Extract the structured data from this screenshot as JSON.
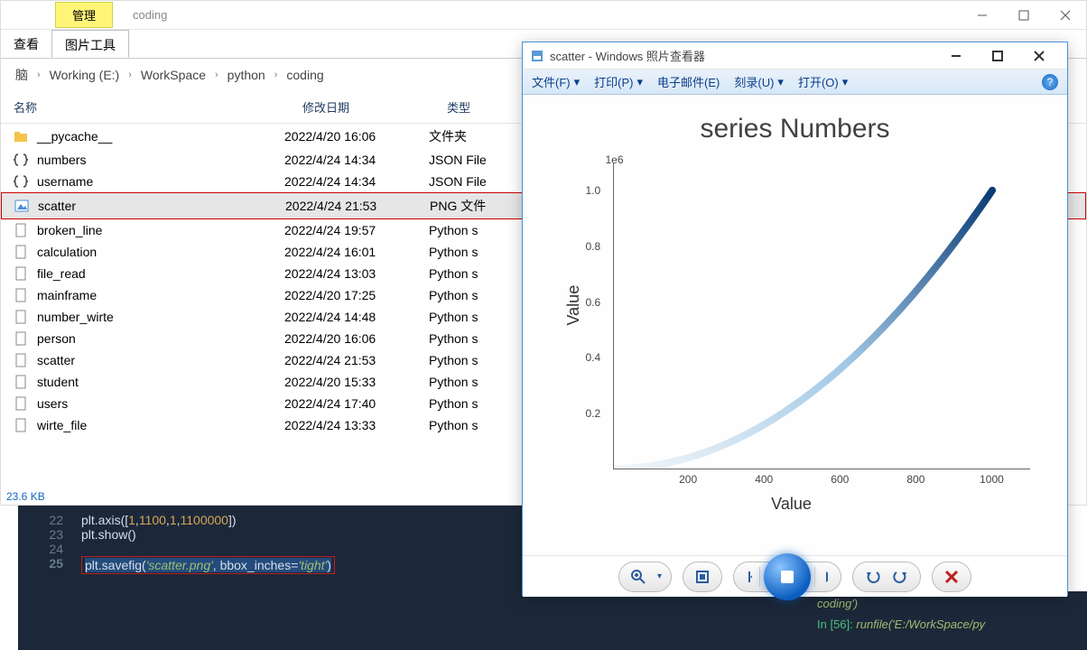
{
  "explorer": {
    "tabs": {
      "highlighted": "管理",
      "secondary": "coding"
    },
    "menubar": {
      "view": "查看",
      "imageTools": "图片工具"
    },
    "breadcrumb": [
      "脑",
      "Working (E:)",
      "WorkSpace",
      "python",
      "coding"
    ],
    "columns": {
      "name": "名称",
      "date": "修改日期",
      "type": "类型"
    },
    "files": [
      {
        "icon": "folder",
        "name": "__pycache__",
        "date": "2022/4/20 16:06",
        "type": "文件夹"
      },
      {
        "icon": "json",
        "name": "numbers",
        "date": "2022/4/24 14:34",
        "type": "JSON File"
      },
      {
        "icon": "json",
        "name": "username",
        "date": "2022/4/24 14:34",
        "type": "JSON File"
      },
      {
        "icon": "image",
        "name": "scatter",
        "date": "2022/4/24 21:53",
        "type": "PNG 文件",
        "selected": true
      },
      {
        "icon": "generic",
        "name": "broken_line",
        "date": "2022/4/24 19:57",
        "type": "Python s"
      },
      {
        "icon": "generic",
        "name": "calculation",
        "date": "2022/4/24 16:01",
        "type": "Python s"
      },
      {
        "icon": "generic",
        "name": "file_read",
        "date": "2022/4/24 13:03",
        "type": "Python s"
      },
      {
        "icon": "generic",
        "name": "mainframe",
        "date": "2022/4/20 17:25",
        "type": "Python s"
      },
      {
        "icon": "generic",
        "name": "number_wirte",
        "date": "2022/4/24 14:48",
        "type": "Python s"
      },
      {
        "icon": "generic",
        "name": "person",
        "date": "2022/4/20 16:06",
        "type": "Python s"
      },
      {
        "icon": "generic",
        "name": "scatter",
        "date": "2022/4/24 21:53",
        "type": "Python s"
      },
      {
        "icon": "generic",
        "name": "student",
        "date": "2022/4/20 15:33",
        "type": "Python s"
      },
      {
        "icon": "generic",
        "name": "users",
        "date": "2022/4/24 17:40",
        "type": "Python s"
      },
      {
        "icon": "generic",
        "name": "wirte_file",
        "date": "2022/4/24 13:33",
        "type": "Python s"
      }
    ],
    "status": "23.6 KB"
  },
  "photoviewer": {
    "title": "scatter - Windows 照片查看器",
    "menu": {
      "file": "文件(F)",
      "print": "打印(P)",
      "email": "电子邮件(E)",
      "burn": "刻录(U)",
      "open": "打开(O)"
    }
  },
  "chart_data": {
    "type": "scatter",
    "title": "series Numbers",
    "notation": "1e6",
    "xlabel": "Value",
    "ylabel": "Value",
    "xlim": [
      1,
      1100
    ],
    "ylim": [
      1,
      1100000
    ],
    "xticks": [
      200,
      400,
      600,
      800,
      1000
    ],
    "yticks": [
      0.2,
      0.4,
      0.6,
      0.8,
      1.0
    ],
    "description": "y = x^2 for x in 1..1000, rendered as a colormap gradient from pale to deep blue"
  },
  "code": {
    "lines": [
      {
        "no": "22",
        "content_plain": "plt.axis([1,1100,1,1100000])",
        "highlight": false
      },
      {
        "no": "23",
        "content_plain": "plt.show()",
        "highlight": false
      },
      {
        "no": "24",
        "content_plain": "",
        "highlight": false
      },
      {
        "no": "25",
        "content_plain": "plt.savefig('scatter.png', bbox_inches='tight')",
        "highlight": true
      }
    ]
  },
  "console": {
    "line1": "coding')",
    "promptNum": "56",
    "call": "runfile('E:/WorkSpace/py"
  }
}
